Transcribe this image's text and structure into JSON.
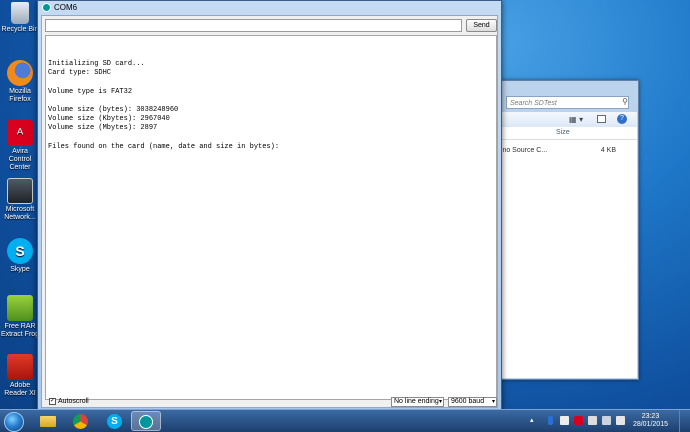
{
  "desktop": {
    "icons": [
      {
        "label": "Recycle Bin"
      },
      {
        "label": "Mozilla Firefox"
      },
      {
        "label": "Avira Control Center"
      },
      {
        "label": "Microsoft Network..."
      },
      {
        "label": "Skype"
      },
      {
        "label": "Free RAR Extract Frog"
      },
      {
        "label": "Adobe Reader XI"
      }
    ]
  },
  "explorer": {
    "search_placeholder": "Search SDTest",
    "column_size": "Size",
    "row_name": "uino Source C...",
    "row_size": "4 KB"
  },
  "monitor": {
    "title": "COM6",
    "send_label": "Send",
    "input_value": "",
    "console_lines": [
      "Initializing SD card...",
      "Card type: SDHC",
      "",
      "Volume type is FAT32",
      "",
      "Volume size (bytes): 3038248960",
      "Volume size (Kbytes): 2967040",
      "Volume size (Mbytes): 2897",
      "",
      "Files found on the card (name, date and size in bytes):"
    ],
    "autoscroll_label": "Autoscroll",
    "autoscroll_checked": true,
    "line_ending": "No line ending",
    "baud": "9600 baud"
  },
  "taskbar": {
    "apps": [
      "explorer",
      "chrome",
      "skype",
      "arduino"
    ],
    "time": "23:23",
    "date": "28/01/2015"
  },
  "colors": {
    "desktop": "#1f78c9",
    "taskbar": "#1d3f6e",
    "arduino": "#00979c"
  }
}
